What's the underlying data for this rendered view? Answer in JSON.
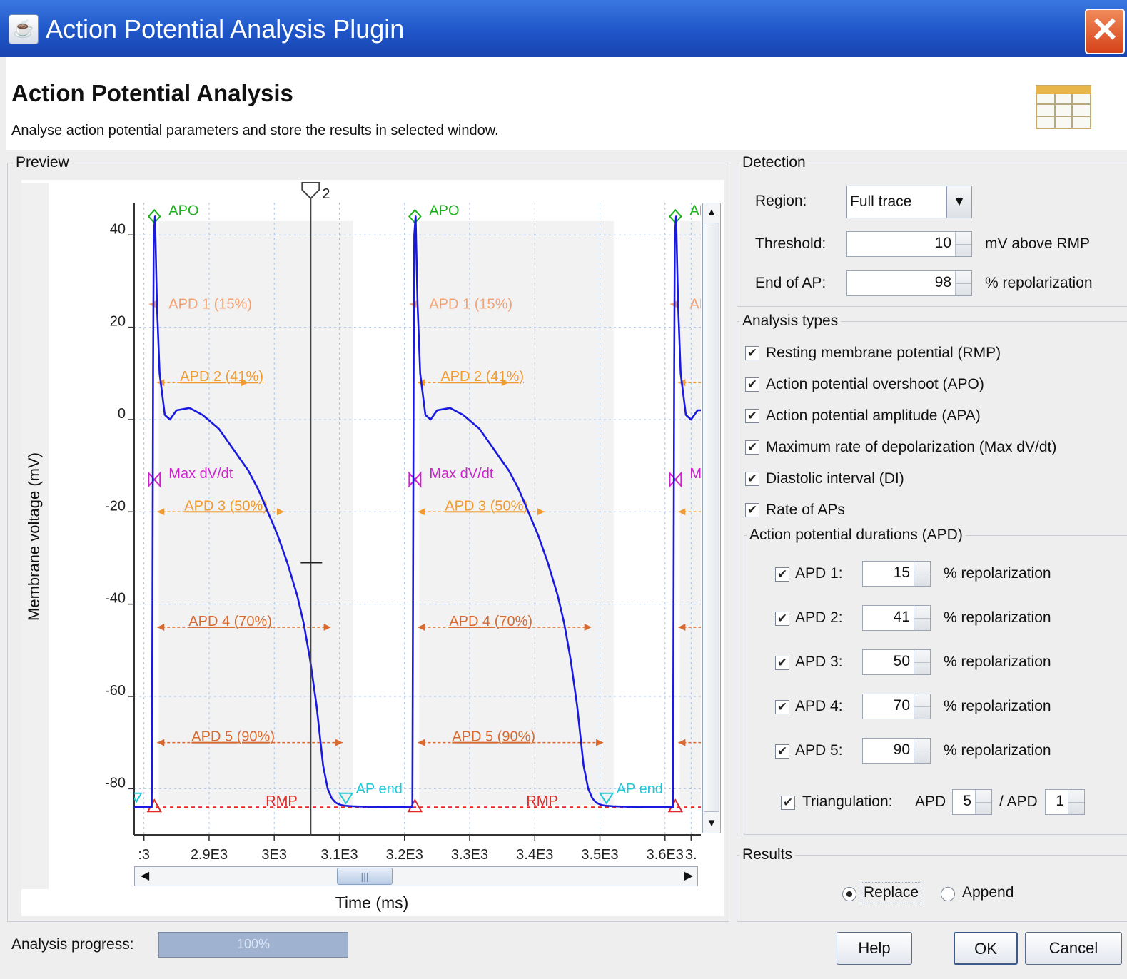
{
  "window": {
    "title": "Action Potential Analysis Plugin"
  },
  "header": {
    "title": "Action Potential Analysis",
    "description": "Analyse action potential parameters and store the results in selected window."
  },
  "preview": {
    "label": "Preview",
    "cursor_label": "2",
    "markers": {
      "apo": "APO",
      "apd1": "APD 1 (15%)",
      "apd2": "APD 2 (41%)",
      "maxdvdt": "Max dV/dt",
      "apd3": "APD 3 (50%)",
      "apd4": "APD 4 (70%)",
      "apd5": "APD 5 (90%)",
      "rmp": "RMP",
      "ap_end": "AP end"
    },
    "colors": {
      "trace": "#1a1adf",
      "apo": "#1ab21a",
      "apd1": "#f4a070",
      "apd2": "#f09a30",
      "maxdvdt": "#cc22cc",
      "apd3": "#f09a30",
      "apd4": "#d86a30",
      "apd5": "#d86a30",
      "rmp": "#e02828",
      "ap_end": "#22c8d8"
    }
  },
  "chart_data": {
    "type": "line",
    "xlabel": "Time (ms)",
    "ylabel": "Membrane voltage (mV)",
    "ylim": [
      -90,
      47
    ],
    "xlim": [
      2785,
      3655
    ],
    "x_ticks": [
      ":3",
      "2.9E3",
      "3E3",
      "3.1E3",
      "3.2E3",
      "3.3E3",
      "3.4E3",
      "3.5E3",
      "3.6E3",
      "3."
    ],
    "x_tick_values": [
      2800,
      2900,
      3000,
      3100,
      3200,
      3300,
      3400,
      3500,
      3600,
      3640
    ],
    "y_ticks": [
      40,
      20,
      0,
      -20,
      -40,
      -60,
      -80
    ],
    "grid": true,
    "cursor_x": 3056,
    "series": [
      {
        "x": [
          2785,
          2812,
          2813,
          2814,
          2815,
          2817,
          2820,
          2824,
          2832,
          2840,
          2850,
          2870,
          2890,
          2915,
          2935,
          2950,
          2960,
          2975,
          2990,
          3005,
          3020,
          3035,
          3045,
          3055,
          3065,
          3075,
          3082,
          3088,
          3094,
          3100,
          3104,
          3110,
          3120,
          3140,
          3170,
          3190,
          3212,
          3213,
          3214,
          3215,
          3217,
          3220,
          3224,
          3232,
          3240,
          3250,
          3270,
          3290,
          3315,
          3335,
          3350,
          3360,
          3375,
          3390,
          3405,
          3420,
          3435,
          3445,
          3455,
          3465,
          3475,
          3482,
          3488,
          3494,
          3500,
          3504,
          3510,
          3520,
          3540,
          3570,
          3590,
          3612,
          3613,
          3614,
          3615,
          3617,
          3620,
          3624,
          3632,
          3640,
          3650,
          3655
        ],
        "y": [
          -84,
          -84,
          -40,
          10,
          40,
          44,
          25,
          10,
          1,
          0,
          2,
          2.5,
          1,
          -2,
          -6,
          -9,
          -11,
          -15,
          -20,
          -25,
          -31,
          -38,
          -44,
          -52,
          -62,
          -75,
          -80,
          -82,
          -83,
          -83.4,
          -83.6,
          -83.7,
          -83.8,
          -83.9,
          -84,
          -84,
          -84,
          -40,
          10,
          40,
          44,
          25,
          10,
          1,
          0,
          2,
          2.5,
          1,
          -2,
          -6,
          -9,
          -11,
          -15,
          -20,
          -25,
          -31,
          -38,
          -44,
          -52,
          -62,
          -75,
          -80,
          -82,
          -83,
          -83.4,
          -83.6,
          -83.7,
          -83.8,
          -83.9,
          -84,
          -84,
          -84,
          -40,
          10,
          40,
          44,
          25,
          10,
          1,
          0,
          2,
          2
        ]
      }
    ],
    "annotations": {
      "apo_x": [
        2816,
        3216,
        3616
      ],
      "apo_y": 44,
      "apd1_y": 25,
      "apd2_y": 8,
      "maxdvdt_y": -13,
      "apd3_y": -20,
      "apd4_y": -45,
      "apd5_y": -70,
      "rmp_y": -84,
      "apd2_end_x": [
        2960,
        3360
      ],
      "apd3_end_x": [
        3015,
        3415
      ],
      "apd4_end_x": [
        3087,
        3487
      ],
      "apd5_end_x": [
        3105,
        3505
      ],
      "apend_x": [
        3110,
        3510
      ]
    }
  },
  "detection": {
    "label": "Detection",
    "region_label": "Region:",
    "region_value": "Full trace",
    "threshold_label": "Threshold:",
    "threshold_value": "10",
    "threshold_unit": "mV above RMP",
    "end_label": "End of AP:",
    "end_value": "98",
    "end_unit": "% repolarization"
  },
  "analysis": {
    "label": "Analysis types",
    "items": [
      {
        "label": "Resting membrane potential (RMP)",
        "checked": true
      },
      {
        "label": "Action potential overshoot (APO)",
        "checked": true
      },
      {
        "label": "Action potential amplitude (APA)",
        "checked": true
      },
      {
        "label": "Maximum rate of depolarization (Max dV/dt)",
        "checked": true
      },
      {
        "label": "Diastolic interval (DI)",
        "checked": true
      },
      {
        "label": "Rate of APs",
        "checked": true
      }
    ],
    "apd_group_label": "Action potential durations (APD)",
    "apd": [
      {
        "label": "APD 1:",
        "value": "15",
        "unit": "% repolarization",
        "checked": true
      },
      {
        "label": "APD 2:",
        "value": "41",
        "unit": "% repolarization",
        "checked": true
      },
      {
        "label": "APD 3:",
        "value": "50",
        "unit": "% repolarization",
        "checked": true
      },
      {
        "label": "APD 4:",
        "value": "70",
        "unit": "% repolarization",
        "checked": true
      },
      {
        "label": "APD 5:",
        "value": "90",
        "unit": "% repolarization",
        "checked": true
      }
    ],
    "triangulation": {
      "label": "Triangulation:",
      "apd_a_label": "APD",
      "apd_a_value": "5",
      "apd_b_label": "/ APD",
      "apd_b_value": "1",
      "checked": true
    }
  },
  "results": {
    "label": "Results",
    "replace": "Replace",
    "append": "Append",
    "selected": "replace"
  },
  "footer": {
    "progress_label": "Analysis progress:",
    "progress_text": "100%",
    "progress_fraction": 1.0,
    "help": "Help",
    "ok": "OK",
    "cancel": "Cancel"
  }
}
